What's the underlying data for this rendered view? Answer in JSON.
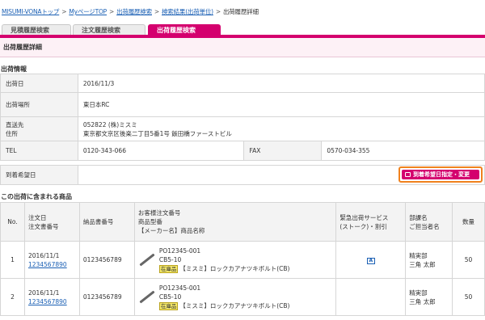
{
  "breadcrumb": {
    "items": [
      "MISUMI-VONAトップ",
      "MyページTOP",
      "出荷履歴検索",
      "検索結果(出荷単位)"
    ],
    "current": "出荷履歴詳細",
    "sep": ">"
  },
  "tabs": [
    {
      "label": "見積履歴検索",
      "active": false
    },
    {
      "label": "注文履歴検索",
      "active": false
    },
    {
      "label": "出荷履歴検索",
      "active": true
    }
  ],
  "page_title": "出荷履歴詳細",
  "shipping": {
    "section_title": "出荷情報",
    "date_label": "出荷日",
    "date": "2016/11/3",
    "place_label": "出荷場所",
    "place": "東日本RC",
    "dest_label1": "直送先",
    "dest_label2": "住所",
    "dest_line1": "052822 (株)ミスミ",
    "dest_line2": "東京都文京区後楽二丁目5番1号 飯田橋ファーストビル",
    "tel_label": "TEL",
    "tel": "0120-343-066",
    "fax_label": "FAX",
    "fax": "0570-034-355",
    "desired_label": "到着希望日",
    "desired_button": "到着希望日指定・変更"
  },
  "items_section": {
    "title": "この出荷に含まれる商品",
    "headers": {
      "no": "No.",
      "order": [
        "注文日",
        "注文書番号"
      ],
      "delivery": "納品書番号",
      "product": [
        "お客様注文番号",
        "商品型番",
        "【メーカー名】商品名称"
      ],
      "service": [
        "緊急出荷サービス",
        "(ストーク)・割引"
      ],
      "dept": [
        "部課名",
        "ご担当者名"
      ],
      "qty": "数量"
    },
    "rows": [
      {
        "no": "1",
        "order_date": "2016/11/1",
        "order_no": "1234567890",
        "delivery_no": "0123456789",
        "cust_po": "PO12345-001",
        "part": "CB5-10",
        "tag": "在庫品",
        "name": "【ミスミ】ロックカアナツキボルト(CB)",
        "service_icon": "A",
        "dept": "精実部",
        "person": "三角 太郎",
        "qty": "50"
      },
      {
        "no": "2",
        "order_date": "2016/11/1",
        "order_no": "1234567890",
        "delivery_no": "0123456789",
        "cust_po": "PO12345-001",
        "part": "CB5-10",
        "tag": "在庫品",
        "name": "【ミスミ】ロックカアナツキボルト(CB)",
        "service_icon": "",
        "dept": "精実部",
        "person": "三角 太郎",
        "qty": "50"
      }
    ]
  },
  "colors": {
    "accent": "#d4006e",
    "highlight": "#f0821e",
    "link": "#1a5fb4"
  }
}
